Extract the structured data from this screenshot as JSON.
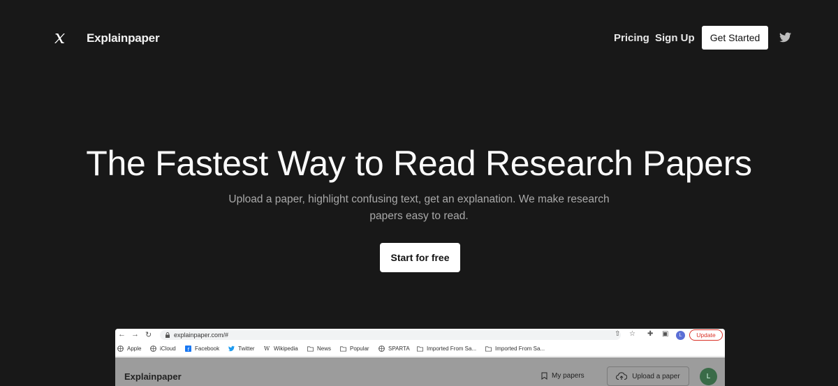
{
  "nav": {
    "logo_glyph": "x",
    "brand": "Explainpaper",
    "pricing": "Pricing",
    "sign_up": "Sign Up",
    "get_started": "Get Started",
    "twitter_icon": "twitter-icon"
  },
  "hero": {
    "title": "The Fastest Way to Read Research Papers",
    "subtitle": "Upload a paper, highlight confusing text, get an explanation. We make research papers easy to read.",
    "cta": "Start for free"
  },
  "preview": {
    "url": "explainpaper.com/#",
    "profile_initial": "L",
    "update_label": "Update",
    "bookmarks": [
      {
        "label": "Apple",
        "icon": "globe-icon"
      },
      {
        "label": "iCloud",
        "icon": "globe-icon"
      },
      {
        "label": "Facebook",
        "icon": "facebook-icon"
      },
      {
        "label": "Twitter",
        "icon": "twitter-icon"
      },
      {
        "label": "Wikipedia",
        "icon": "wikipedia-icon"
      },
      {
        "label": "News",
        "icon": "folder-icon"
      },
      {
        "label": "Popular",
        "icon": "folder-icon"
      },
      {
        "label": "SPARTA",
        "icon": "globe-icon"
      },
      {
        "label": "Imported From Sa...",
        "icon": "folder-icon"
      },
      {
        "label": "Imported From Sa...",
        "icon": "folder-icon"
      }
    ],
    "app": {
      "brand": "Explainpaper",
      "my_papers": "My papers",
      "upload": "Upload a paper",
      "avatar_initial": "L"
    }
  },
  "colors": {
    "background": "#181818",
    "button_bg": "#ffffff",
    "subtitle": "#a9a9a9"
  }
}
